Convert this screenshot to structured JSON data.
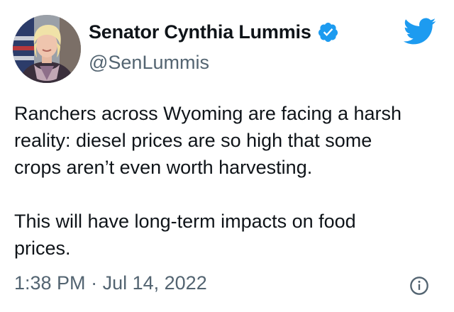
{
  "author": {
    "display_name": "Senator Cynthia Lummis",
    "handle": "@SenLummis",
    "verified": true,
    "avatar_icon": "profile-photo"
  },
  "tweet": {
    "paragraph_1": "Ranchers across Wyoming are facing a harsh\nreality: diesel prices are so high that some\ncrops aren’t even worth harvesting.",
    "paragraph_2": "This will have long-term impacts on food\nprices.",
    "time": "1:38 PM",
    "separator": "·",
    "date": "Jul 14, 2022"
  },
  "icons": {
    "brand": "twitter-bird-icon",
    "verified": "verified-badge-icon",
    "info": "info-icon"
  },
  "colors": {
    "brand_blue": "#1d9bf0",
    "text_primary": "#0f1419",
    "text_secondary": "#536471"
  }
}
